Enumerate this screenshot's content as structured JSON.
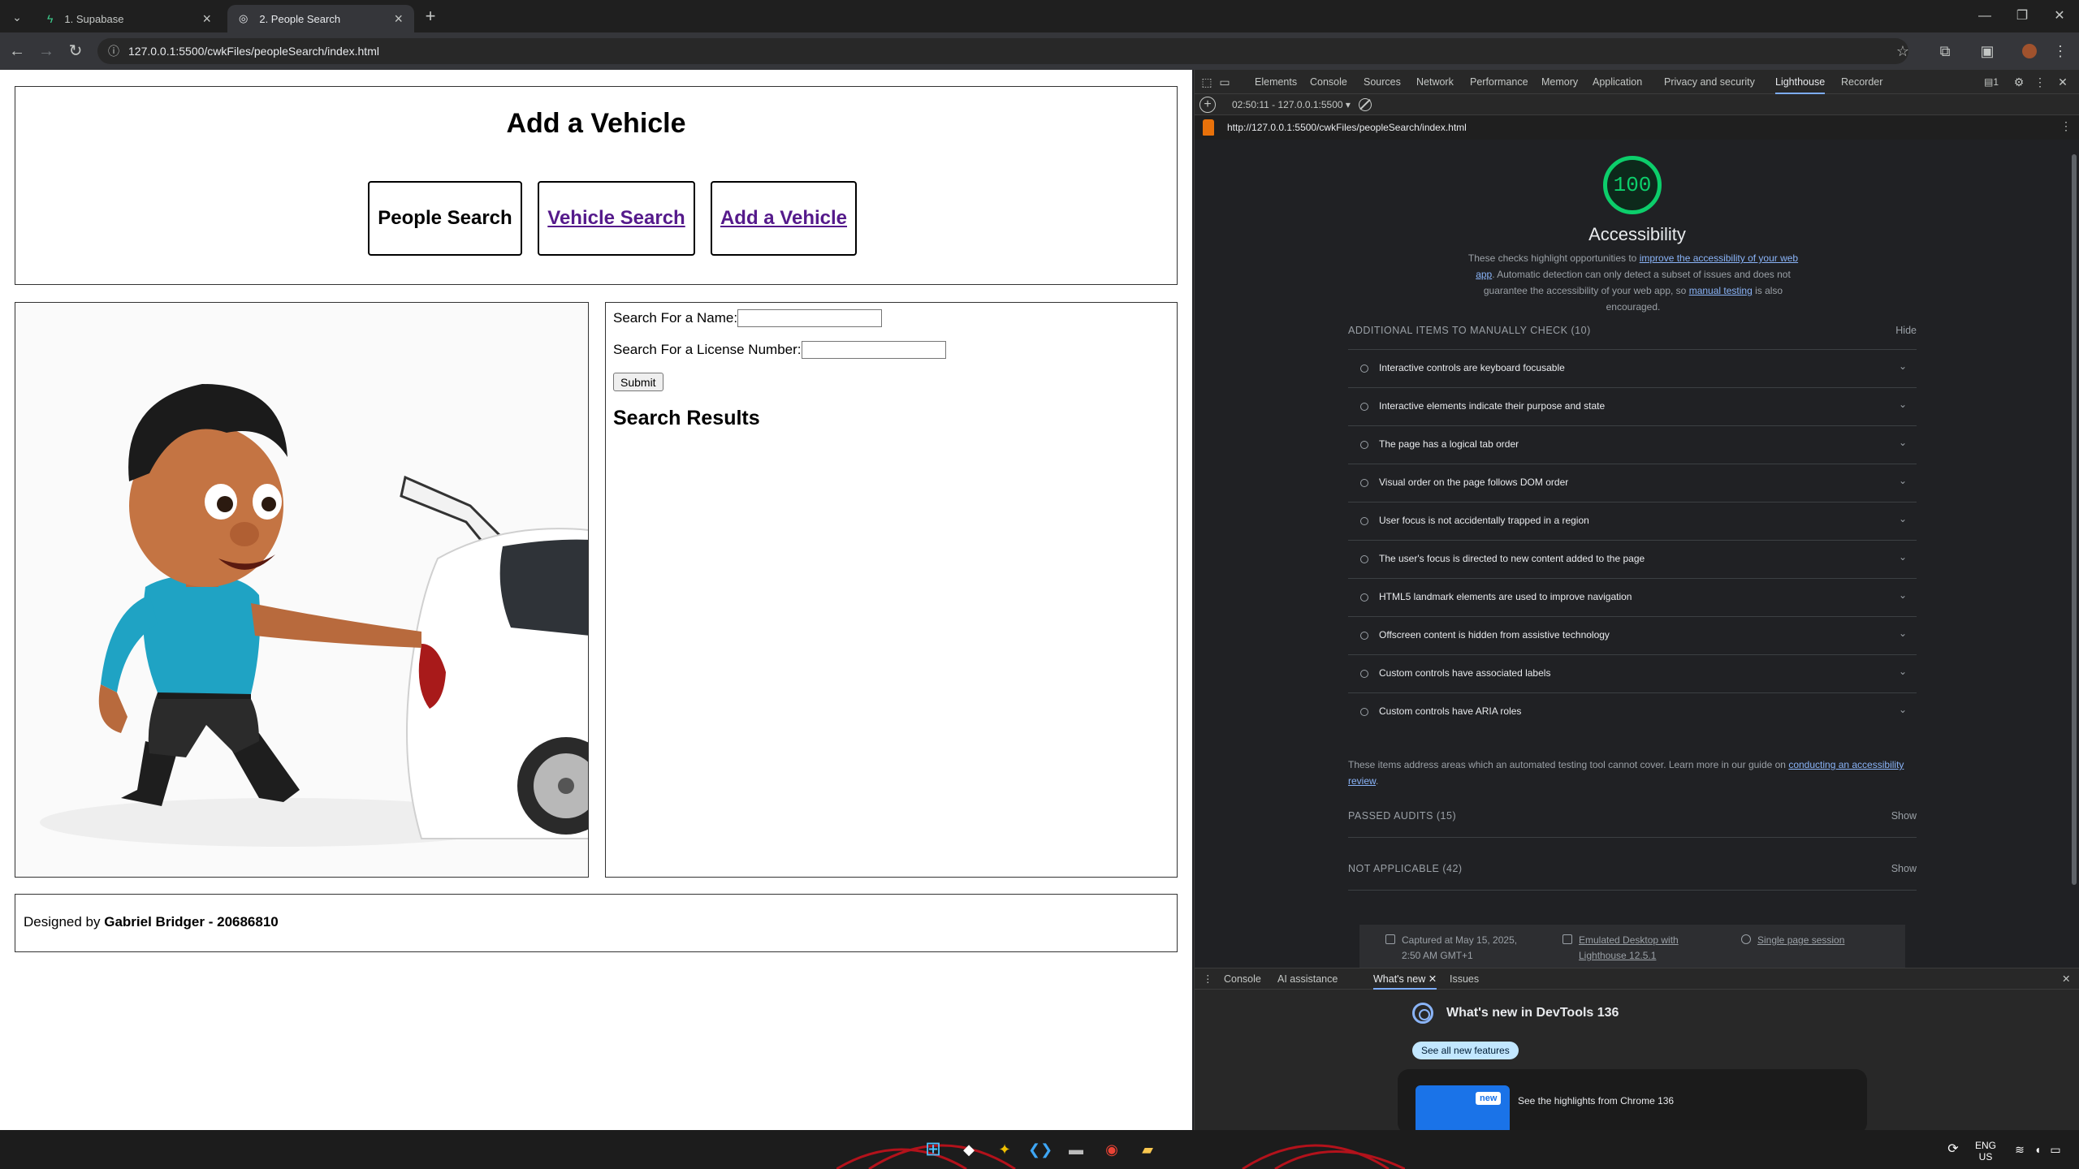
{
  "browser": {
    "tabs": [
      {
        "label": "1. Supabase"
      },
      {
        "label": "2. People Search"
      }
    ],
    "url": "127.0.0.1:5500/cwkFiles/peopleSearch/index.html"
  },
  "page": {
    "heading": "Add a Vehicle",
    "nav": [
      {
        "label": "People Search"
      },
      {
        "label": "Vehicle Search"
      },
      {
        "label": "Add a Vehicle"
      }
    ],
    "form": {
      "name_label": "Search For a Name:",
      "name_value": "",
      "license_label": "Search For a License Number:",
      "license_value": "",
      "submit_label": "Submit",
      "results_heading": "Search Results"
    },
    "footer": {
      "prefix": "Designed by",
      "author": "Gabriel Bridger - 20686810"
    }
  },
  "devtools": {
    "tabs": [
      "Elements",
      "Console",
      "Sources",
      "Network",
      "Performance",
      "Memory",
      "Application",
      "Privacy and security",
      "Lighthouse",
      "Recorder"
    ],
    "active_tab": "Lighthouse",
    "issues_count": "1",
    "session": "02:50:11 - 127.0.0.1:5500",
    "report_url": "http://127.0.0.1:5500/cwkFiles/peopleSearch/index.html",
    "score": "100",
    "score_color": "#0cce6b",
    "category": "Accessibility",
    "description": {
      "part1": "These checks highlight opportunities to ",
      "link1": "improve the accessibility of your web app",
      "part2": ". Automatic detection can only detect a subset of issues and does not guarantee the accessibility of your web app, so ",
      "link2": "manual testing",
      "part3": " is also encouraged."
    },
    "manual_header": "ADDITIONAL ITEMS TO MANUALLY CHECK (10)",
    "manual_toggle": "Hide",
    "manual_items": [
      "Interactive controls are keyboard focusable",
      "Interactive elements indicate their purpose and state",
      "The page has a logical tab order",
      "Visual order on the page follows DOM order",
      "User focus is not accidentally trapped in a region",
      "The user's focus is directed to new content added to the page",
      "HTML5 landmark elements are used to improve navigation",
      "Offscreen content is hidden from assistive technology",
      "Custom controls have associated labels",
      "Custom controls have ARIA roles"
    ],
    "note": {
      "text": "These items address areas which an automated testing tool cannot cover. Learn more in our guide on ",
      "link": "conducting an accessibility review",
      "end": "."
    },
    "passed": {
      "label": "PASSED AUDITS (15)",
      "toggle": "Show"
    },
    "not_applicable": {
      "label": "NOT APPLICABLE (42)",
      "toggle": "Show"
    },
    "env": {
      "captured": "Captured at May 15, 2025, 2:50 AM GMT+1",
      "emulated": "Emulated Desktop with Lighthouse 12.5.1",
      "session": "Single page session"
    },
    "drawer": {
      "tabs": [
        "Console",
        "AI assistance",
        "What's new",
        "Issues"
      ],
      "active_tab": "What's new",
      "title": "What's new in DevTools 136",
      "button": "See all new features",
      "badge": "new",
      "card_text": "See the highlights from Chrome 136"
    }
  },
  "taskbar": {
    "lang": "ENG",
    "region": "US"
  }
}
